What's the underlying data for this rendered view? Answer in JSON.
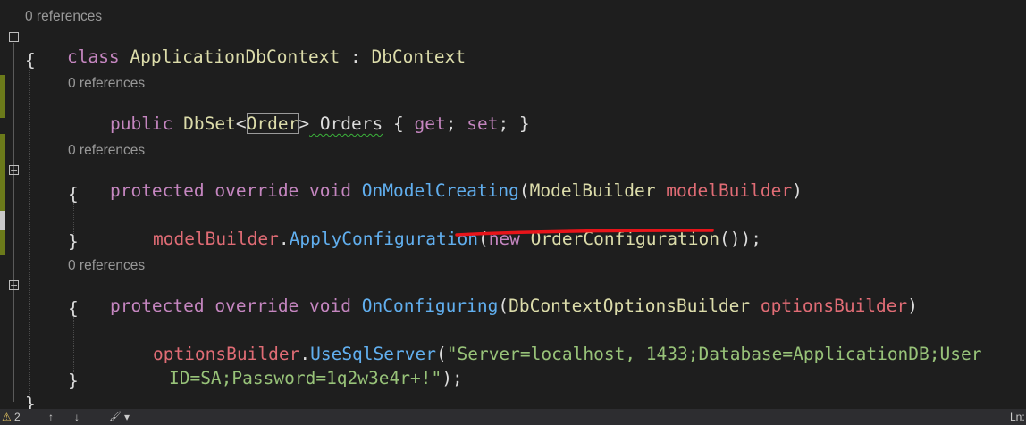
{
  "code_lens": {
    "class_refs": "0 references",
    "orders_refs": "0 references",
    "onmodel_refs": "0 references",
    "onconfig_refs": "0 references"
  },
  "code": {
    "l1": {
      "kw": "class",
      "name": " ApplicationDbContext",
      "colon": " : ",
      "base": "DbContext"
    },
    "l2": "{",
    "l3": {
      "kw": "public",
      "type": " DbSet",
      "lt": "<",
      "generic": "Order",
      "gt": ">",
      "prop": " Orders",
      "acc_open": " { ",
      "get": "get",
      "semi1": "; ",
      "set": "set",
      "acc_close": "; }"
    },
    "l4": {
      "kw1": "protected",
      "kw2": " override",
      "kw3": " void",
      "method": " OnModelCreating",
      "po": "(",
      "ptype": "ModelBuilder",
      "pname": " modelBuilder",
      "pc": ")"
    },
    "l5": "{",
    "l6": {
      "obj": "modelBuilder",
      "dot": ".",
      "call": "ApplyConfiguration",
      "po": "(",
      "new": "new",
      "cls": " OrderConfiguration",
      "end": "());"
    },
    "l7": "}",
    "l8": {
      "kw1": "protected",
      "kw2": " override",
      "kw3": " void",
      "method": " OnConfiguring",
      "po": "(",
      "ptype": "DbContextOptionsBuilder",
      "pname": " optionsBuilder",
      "pc": ")"
    },
    "l9": "{",
    "l10": {
      "obj": "optionsBuilder",
      "dot": ".",
      "call": "UseSqlServer",
      "po": "(",
      "str1": "\"Server=localhost, 1433;Database=ApplicationDB;User"
    },
    "l11": {
      "str2": "ID=SA;Password=1q2w3e4r+!\"",
      "end": ");"
    },
    "l12": "}",
    "l13": "}"
  },
  "status_bar": {
    "warning_icon": "⚠",
    "warning_count": "2",
    "up_arrow": "↑",
    "down_arrow": "↓",
    "brush_icon": "🖌",
    "dropdown": "▾",
    "ln_label": "Ln:"
  },
  "colors": {
    "background": "#1e1e1e",
    "keyword": "#c586c0",
    "type": "#dcdcaa",
    "method": "#61afef",
    "parameter": "#e06c75",
    "string": "#98c379",
    "annotation_red": "#e8141a"
  }
}
